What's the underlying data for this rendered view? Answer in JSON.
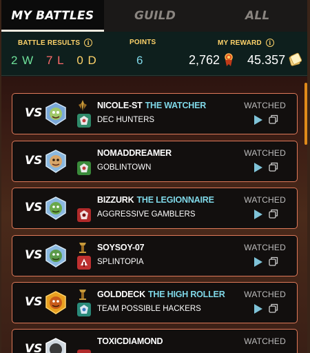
{
  "tabs": [
    {
      "label": "MY BATTLES",
      "active": true
    },
    {
      "label": "GUILD",
      "active": false
    },
    {
      "label": "ALL",
      "active": false
    }
  ],
  "summary": {
    "battle_results_label": "BATTLE RESULTS",
    "wins": "2 W",
    "losses": "7 L",
    "draws": "0 D",
    "points_label": "POINTS",
    "points": "6",
    "my_reward_label": "MY REWARD",
    "reward_amount": "2,762",
    "reward_tokens": "45.357",
    "info_glyph": "i"
  },
  "colors": {
    "accent_gold": "#ffd36a",
    "win": "#6ee09a",
    "loss": "#ff6b6b",
    "title_cyan": "#7fd8e8",
    "card_border": "#e07a5a"
  },
  "battles": [
    {
      "vs": "VS",
      "player": "NICOLE-ST",
      "title": "THE WATCHER",
      "guild": "DEC HUNTERS",
      "status": "WATCHED"
    },
    {
      "vs": "VS",
      "player": "NOMADDREAMER",
      "title": "",
      "guild": "GOBLINTOWN",
      "status": "WATCHED"
    },
    {
      "vs": "VS",
      "player": "BIZZURK",
      "title": "THE LEGIONNAIRE",
      "guild": "AGGRESSIVE GAMBLERS",
      "status": "WATCHED"
    },
    {
      "vs": "VS",
      "player": "SOYSOY-07",
      "title": "",
      "guild": "SPLINTOPIA",
      "status": "WATCHED"
    },
    {
      "vs": "VS",
      "player": "GOLDDECK",
      "title": "THE HIGH ROLLER",
      "guild": "TEAM POSSIBLE HACKERS",
      "status": "WATCHED"
    },
    {
      "vs": "VS",
      "player": "TOXICDIAMOND",
      "title": "",
      "guild": "",
      "status": "WATCHED"
    }
  ]
}
